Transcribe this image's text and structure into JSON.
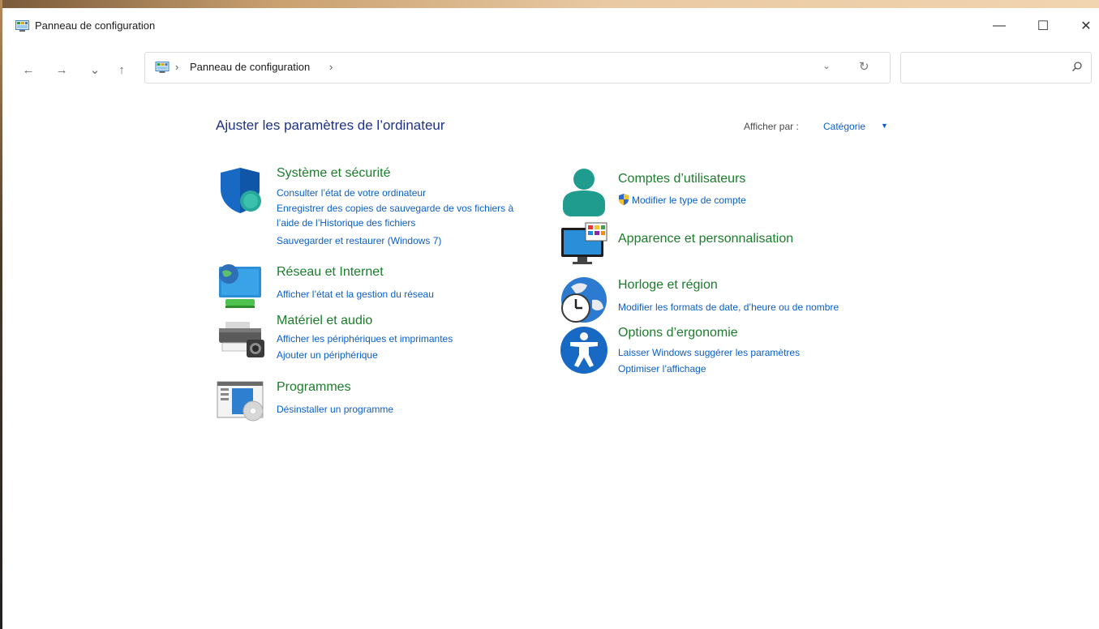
{
  "window": {
    "title": "Panneau de configuration",
    "minimize_glyph": "—",
    "maximize_glyph": "☐",
    "close_glyph": "✕"
  },
  "nav": {
    "back_glyph": "←",
    "forward_glyph": "→",
    "recent_glyph": "⌄",
    "up_glyph": "↑"
  },
  "address": {
    "sep": "›",
    "crumb": "Panneau de configuration",
    "dropdown_glyph": "⌄",
    "refresh_glyph": "↻"
  },
  "search": {
    "placeholder": ""
  },
  "header": {
    "heading": "Ajuster les paramètres de l’ordinateur",
    "view_by_label": "Afficher par :",
    "view_by_value": "Catégorie",
    "view_by_caret": "▼"
  },
  "categories": {
    "system": {
      "title": "Système et sécurité",
      "links": [
        "Consulter l’état de votre ordinateur",
        "Enregistrer des copies de sauvegarde de vos fichiers à",
        "l’aide de l’Historique des fichiers",
        "Sauvegarder et restaurer (Windows 7)"
      ]
    },
    "network": {
      "title": "Réseau et Internet",
      "links": [
        "Afficher l’état et la gestion du réseau"
      ]
    },
    "hardware": {
      "title": "Matériel et audio",
      "links": [
        "Afficher les périphériques et imprimantes",
        "Ajouter un périphérique"
      ]
    },
    "programs": {
      "title": "Programmes",
      "links": [
        "Désinstaller un programme"
      ]
    },
    "accounts": {
      "title": "Comptes d’utilisateurs",
      "links": [
        "Modifier le type de compte"
      ]
    },
    "appearance": {
      "title": "Apparence et personnalisation"
    },
    "clock": {
      "title": "Horloge et région",
      "links": [
        "Modifier les formats de date, d’heure ou de nombre"
      ]
    },
    "ease": {
      "title": "Options d’ergonomie",
      "links": [
        "Laisser Windows suggérer les paramètres",
        "Optimiser l’affichage"
      ]
    }
  },
  "colors": {
    "heading": "#1e3287",
    "category_title": "#1b7d2b",
    "link": "#0b5fcb"
  },
  "icons": {
    "app": "control-panel-icon",
    "system": "shield-icon",
    "network": "globe-monitor-icon",
    "hardware": "printer-icon",
    "programs": "programs-disc-icon",
    "accounts": "user-icon",
    "uac": "uac-shield-icon",
    "appearance": "monitor-palette-icon",
    "clock": "clock-globe-icon",
    "ease": "accessibility-icon"
  }
}
